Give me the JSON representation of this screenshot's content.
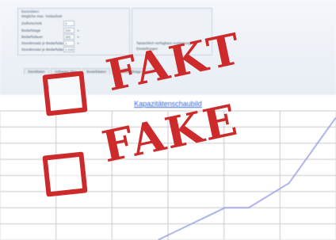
{
  "colors": {
    "stamp": "#cd2b2b",
    "chart_line": "#8a90e0",
    "grid": "#c8c8c8",
    "title": "#3366cc"
  },
  "form": {
    "panel1_title": "Basisdaten",
    "rows": [
      {
        "label": "Mögliche max. Vorlaufzeit",
        "value": ""
      },
      {
        "label": "Zielfortschritt",
        "value": "0"
      },
      {
        "label": "Bedarfstage",
        "value": "290"
      },
      {
        "label": "Bedarfsdauer",
        "value": "365"
      },
      {
        "label": "Stundensatz je Bedarfsdauer",
        "value": "1"
      },
      {
        "label": "Stundensatz je Bedarfsdauer",
        "value": "1.019"
      }
    ],
    "note_line1": "Tatsächlich verfügbare Auslastung",
    "note_line2": "Einstellungen",
    "tabs": [
      "Stücklisten",
      "Anfragen über",
      "Bestelldaten",
      "Kundenaufträge über"
    ]
  },
  "chart_data": {
    "type": "line",
    "title": "Kapazitätenschaubild",
    "xlabel": "",
    "ylabel": "",
    "series": [
      {
        "points": [
          [
            0.47,
            0.0
          ],
          [
            0.67,
            0.25
          ],
          [
            0.74,
            0.25
          ],
          [
            0.86,
            0.44
          ],
          [
            1.0,
            0.95
          ]
        ]
      }
    ]
  },
  "stamp": {
    "word1": "FAKT",
    "word2": "FAKE"
  }
}
